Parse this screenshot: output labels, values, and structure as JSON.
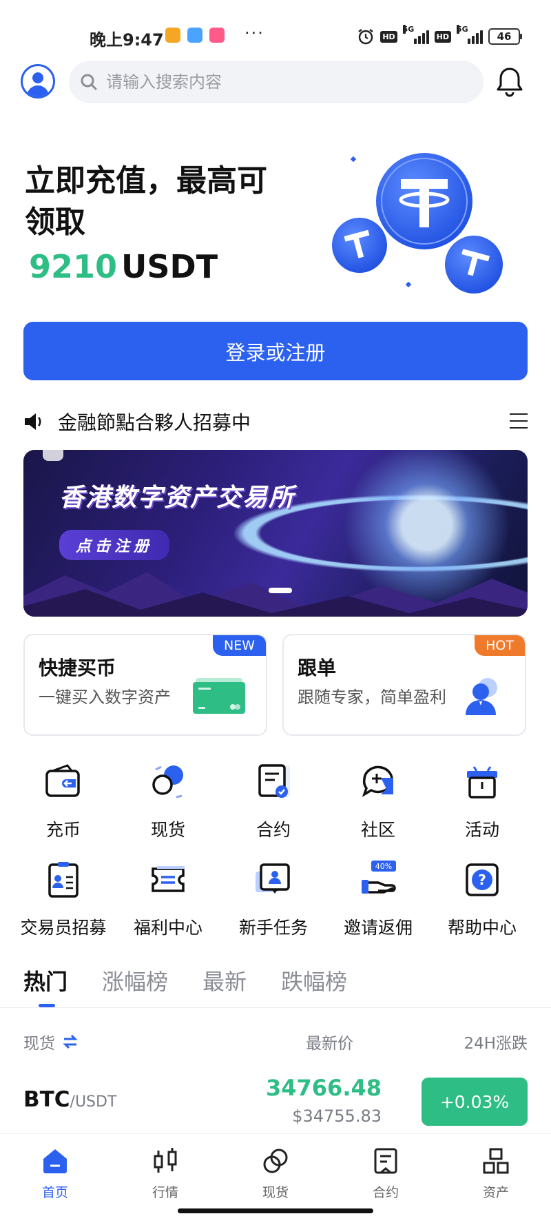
{
  "status_bar": {
    "time": "晚上9:47",
    "net_1": "5G",
    "net_2": "5G",
    "hd": "HD",
    "battery": "46"
  },
  "header": {
    "search_placeholder": "请输入搜索内容",
    "avatar_icon": "user-avatar-icon",
    "bell_icon": "bell-icon"
  },
  "promo": {
    "title": "立即充值，最高可领取",
    "amount": "9210",
    "unit": "USDT",
    "cta": "登录或注册"
  },
  "announcement": {
    "text": "金融節點合夥人招募中"
  },
  "banner": {
    "title": "香港数字资产交易所",
    "cta": "点击注册"
  },
  "cards": [
    {
      "title": "快捷买币",
      "subtitle": "一键买入数字资产",
      "badge": "NEW"
    },
    {
      "title": "跟单",
      "subtitle": "跟随专家，简单盈利",
      "badge": "HOT"
    }
  ],
  "grid": [
    {
      "label": "充币",
      "icon": "wallet-icon"
    },
    {
      "label": "现货",
      "icon": "spot-icon"
    },
    {
      "label": "合约",
      "icon": "contract-icon"
    },
    {
      "label": "社区",
      "icon": "community-icon"
    },
    {
      "label": "活动",
      "icon": "gift-icon"
    },
    {
      "label": "交易员招募",
      "icon": "trader-badge-icon"
    },
    {
      "label": "福利中心",
      "icon": "ticket-icon"
    },
    {
      "label": "新手任务",
      "icon": "task-icon"
    },
    {
      "label": "邀请返佣",
      "icon": "invite-icon",
      "badge": "40%"
    },
    {
      "label": "帮助中心",
      "icon": "help-icon"
    }
  ],
  "market_tabs": [
    "热门",
    "涨幅榜",
    "最新",
    "跌幅榜"
  ],
  "list_header": {
    "col1": "现货",
    "col2": "最新价",
    "col3": "24H涨跌"
  },
  "rows": [
    {
      "base": "BTC",
      "quote": "/USDT",
      "price": "34766.48",
      "fiat": "$34755.83",
      "change": "+0.03%"
    }
  ],
  "colors": {
    "accent": "#2c61f0",
    "up": "#2ebd85",
    "hot": "#f07a2c"
  },
  "bottom_nav": [
    {
      "label": "首页",
      "icon": "home-icon"
    },
    {
      "label": "行情",
      "icon": "market-icon"
    },
    {
      "label": "现货",
      "icon": "spot-nav-icon"
    },
    {
      "label": "合约",
      "icon": "contract-nav-icon"
    },
    {
      "label": "资产",
      "icon": "assets-icon"
    }
  ]
}
